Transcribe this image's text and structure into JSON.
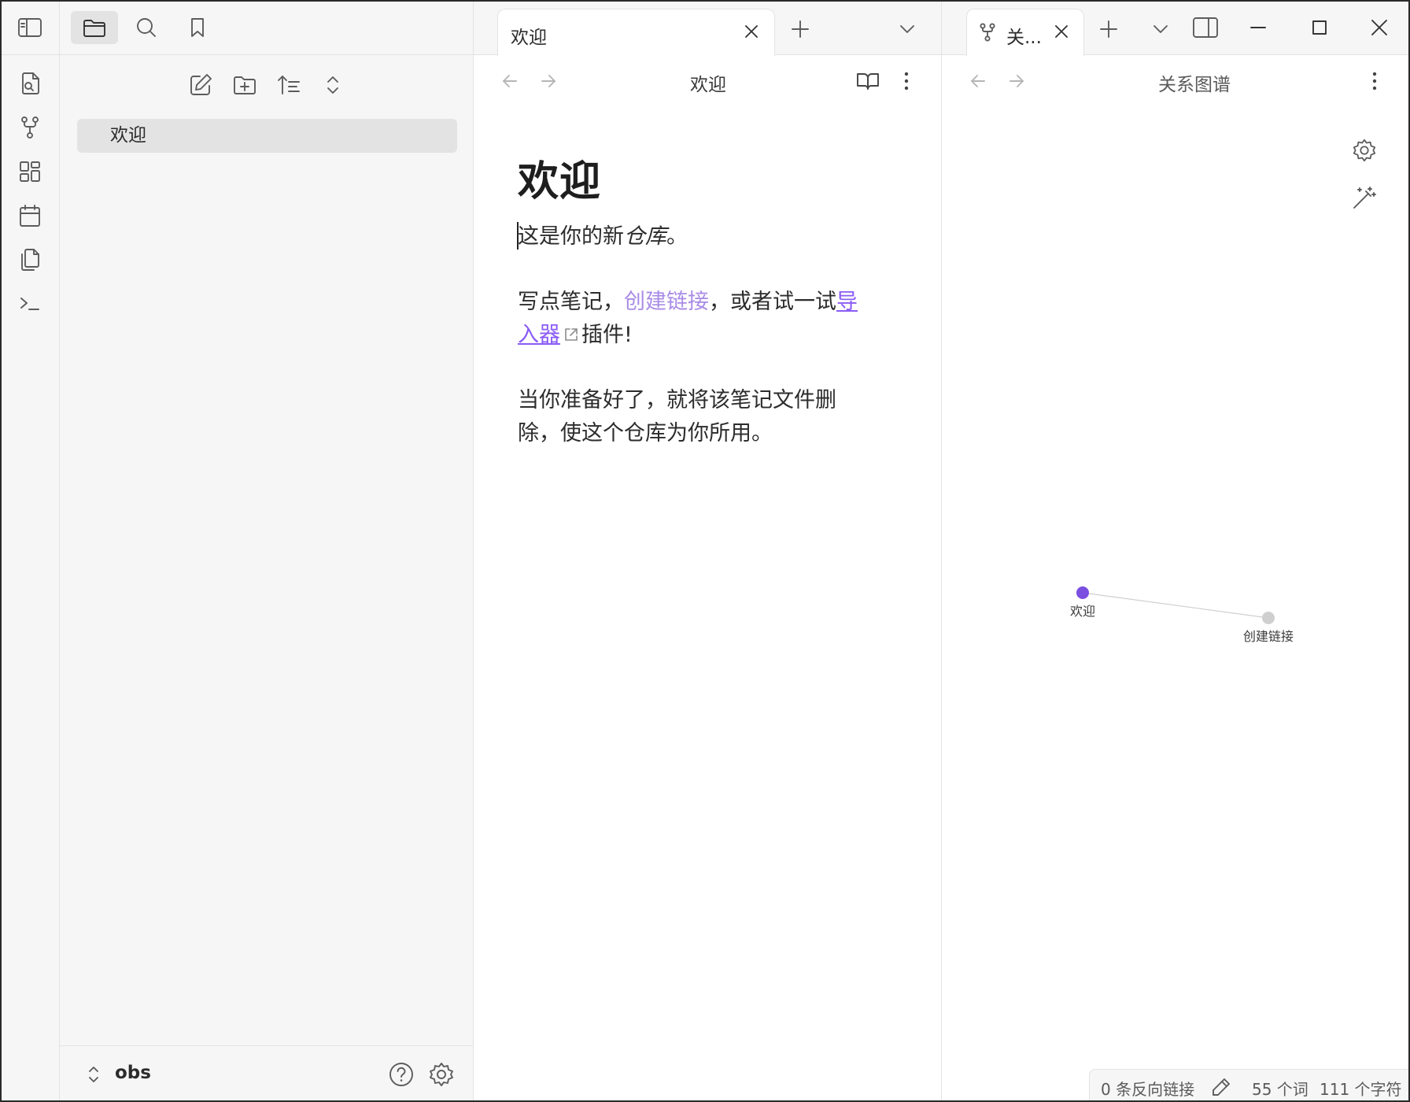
{
  "sidebar": {
    "file_tree": [
      {
        "label": "欢迎"
      }
    ],
    "vault_name": "obs"
  },
  "tabs": {
    "left": {
      "label": "欢迎"
    },
    "right": {
      "label": "关..."
    }
  },
  "editor": {
    "view_title": "欢迎",
    "heading": "欢迎",
    "p1_text": "这是你的新",
    "p1_italic": "仓库",
    "p1_end": "。",
    "p2_start": "写点笔记，",
    "p2_link": "创建链接",
    "p2_mid": "，或者试一试",
    "p2_ext_link_a": "导",
    "p2_ext_link_b": "入器",
    "p2_end": "插件!",
    "p3_line1": "当你准备好了，就将该笔记文件删",
    "p3_line2": "除，使这个仓库为你所用。"
  },
  "graph": {
    "view_title": "关系图谱",
    "nodes": [
      {
        "label": "欢迎",
        "active": true
      },
      {
        "label": "创建链接",
        "active": false
      }
    ],
    "colors": {
      "active_node": "#7b4fe0",
      "inactive_node": "#cfcfcf",
      "edge": "#cfcfcf"
    }
  },
  "status": {
    "backlinks": "0 条反向链接",
    "words": "55 个词",
    "chars": "111 个字符"
  },
  "colors": {
    "accent": "#8a5cf5",
    "internal_link": "#a88be6",
    "sidebar_bg": "#f6f6f6",
    "selection_bg": "#e3e3e3"
  }
}
